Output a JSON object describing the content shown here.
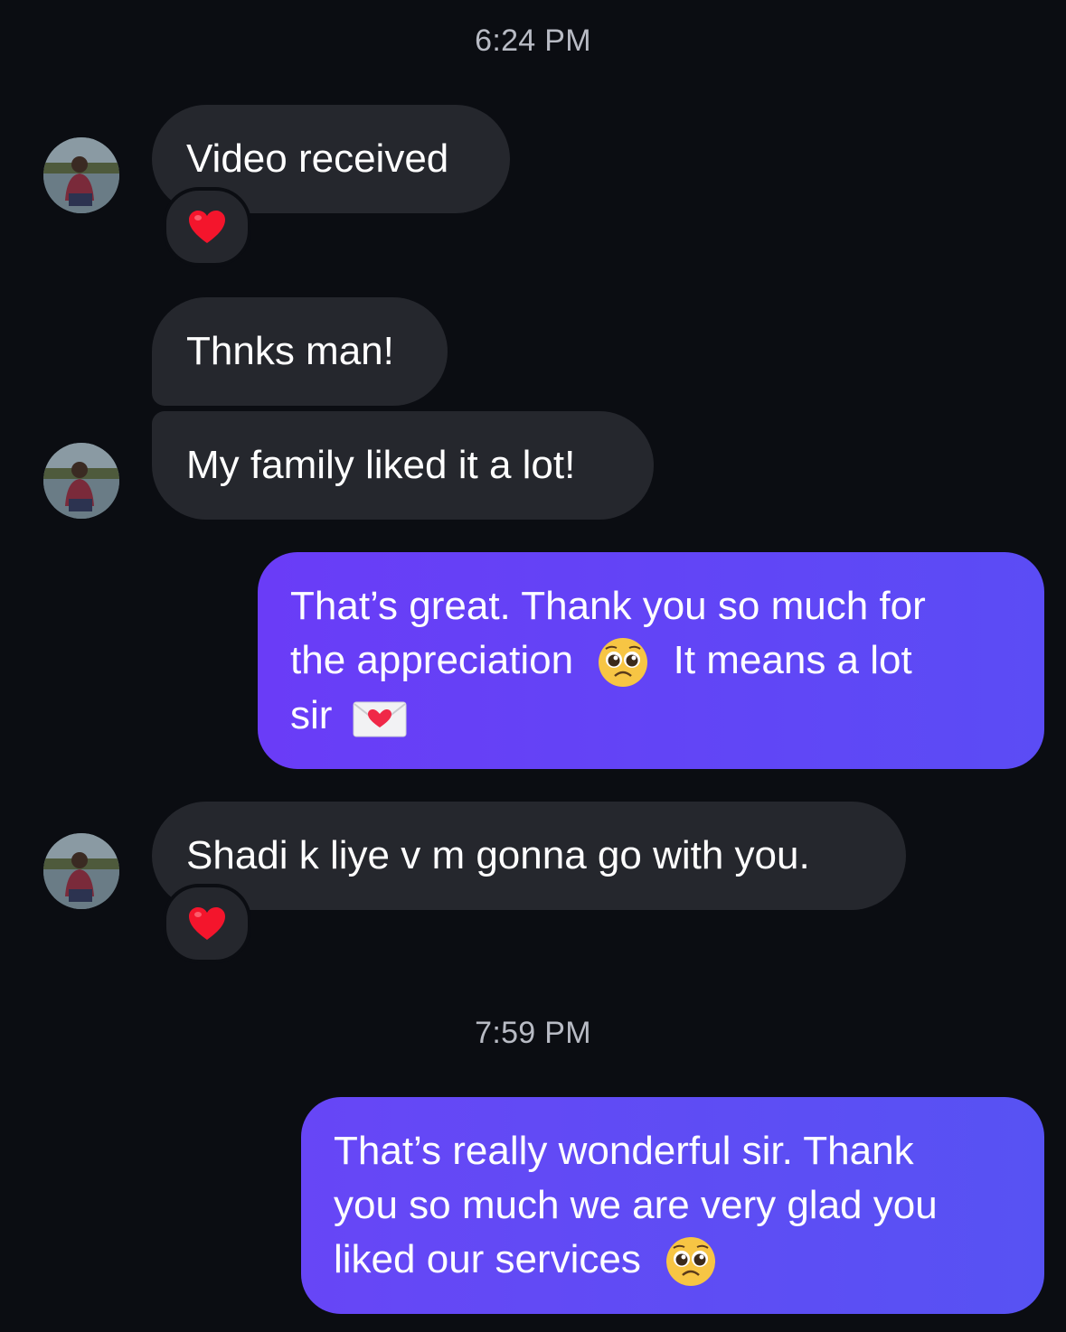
{
  "thread": {
    "timestamps": [
      "6:24 PM",
      "7:59 PM"
    ],
    "messages": [
      {
        "text": "Video received",
        "sender": "other",
        "reaction": "heart"
      },
      {
        "text": "Thnks man!",
        "sender": "other"
      },
      {
        "text": "My family liked it a lot!",
        "sender": "other"
      },
      {
        "line1": "That’s great. Thank you so much for",
        "line2a": "the appreciation",
        "line2b": "It means a lot",
        "line3": "sir",
        "sender": "me",
        "emojis": [
          "pleading-face",
          "love-letter"
        ]
      },
      {
        "text": "Shadi k liye v m gonna go with you.",
        "sender": "other",
        "reaction": "heart"
      },
      {
        "line1": "That’s really wonderful sir. Thank",
        "line2": "you so much we are very glad you",
        "line3": "liked our services",
        "sender": "me",
        "emojis": [
          "pleading-face"
        ]
      }
    ]
  },
  "colors": {
    "background": "#0b0d12",
    "incoming_bubble": "#25272d",
    "outgoing_bubble": "#6a3cf7",
    "timestamp": "#b8bbc4"
  }
}
